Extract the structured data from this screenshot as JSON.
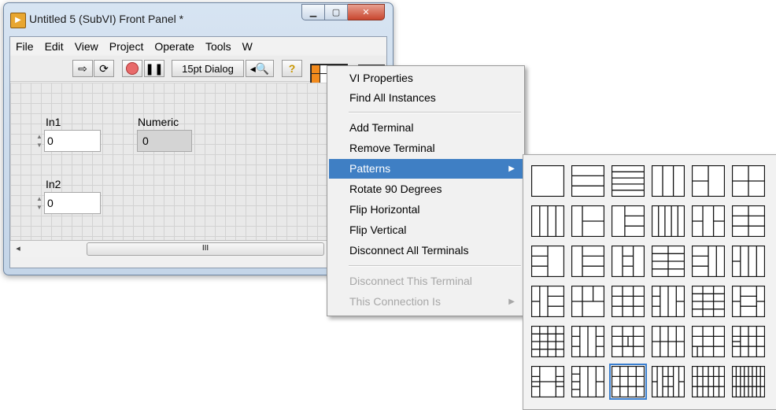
{
  "window": {
    "title": "Untitled 5 (SubVI) Front Panel *",
    "app_icon": "labview-vi-icon",
    "caption_buttons": [
      "minimize-icon",
      "maximize-icon",
      "close-icon"
    ]
  },
  "menubar": [
    "File",
    "Edit",
    "View",
    "Project",
    "Operate",
    "Tools",
    "W"
  ],
  "toolbar": {
    "font_selector": "15pt Dialog"
  },
  "panel": {
    "controls": [
      {
        "label": "In1",
        "value": "0"
      },
      {
        "label": "In2",
        "value": "0"
      }
    ],
    "indicators": [
      {
        "label": "Numeric",
        "value": "0"
      }
    ],
    "scroll_thumb_grip": "III"
  },
  "context_menu": {
    "items": [
      {
        "label": "VI Properties",
        "state": "enabled"
      },
      {
        "label": "Find All Instances",
        "state": "enabled"
      },
      {
        "label": "Add Terminal",
        "state": "enabled"
      },
      {
        "label": "Remove Terminal",
        "state": "enabled"
      },
      {
        "label": "Patterns",
        "state": "highlighted",
        "submenu": true
      },
      {
        "label": "Rotate 90 Degrees",
        "state": "enabled"
      },
      {
        "label": "Flip Horizontal",
        "state": "enabled"
      },
      {
        "label": "Flip Vertical",
        "state": "enabled"
      },
      {
        "label": "Disconnect All Terminals",
        "state": "enabled"
      },
      {
        "label": "Disconnect This Terminal",
        "state": "disabled"
      },
      {
        "label": "This Connection Is",
        "state": "disabled",
        "submenu": true
      }
    ]
  },
  "patterns_palette": {
    "rows": 6,
    "columns": 6,
    "selected_index": 32,
    "highlight_color": "#3a7fd0"
  },
  "colors": {
    "menu_highlight": "#3f7fc4",
    "connector_terminal": "#f28a1c"
  }
}
